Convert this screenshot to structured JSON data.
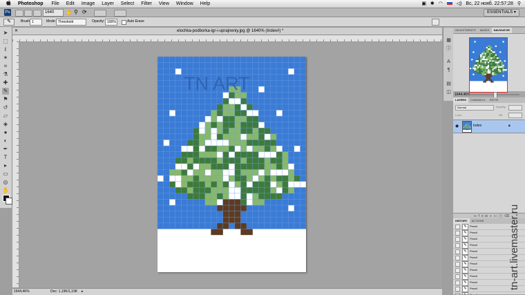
{
  "menubar": {
    "app_name": "Photoshop",
    "menus": [
      "File",
      "Edit",
      "Image",
      "Layer",
      "Select",
      "Filter",
      "View",
      "Window",
      "Help"
    ],
    "clock": "Вс, 22 нояб.  22:57:28"
  },
  "appbar": {
    "logo": "Ps",
    "zoom": "1640",
    "workspace": "ESSENTIALS ▾"
  },
  "options": {
    "brush_label": "Brush:",
    "brush_size": "1",
    "mode_label": "Mode:",
    "mode_value": "Threshold",
    "opacity_label": "Opacity:",
    "opacity_value": "100%",
    "auto_erase_label": "Auto Erase"
  },
  "document": {
    "title": "elochka-podborka-igr-i-uprajneniy.jpg @ 1640% (Index#) *",
    "logo_text": "TN   ART",
    "status_zoom": "1644,46%",
    "status_doc": "Doc: 1,19K/1,19K"
  },
  "panels": {
    "navigator_tabs": [
      "ADJUSTMENTS",
      "MASKS",
      "NAVIGATOR"
    ],
    "nav_zoom": "1644,46%",
    "layers_tabs": [
      "LAYERS",
      "CHANNELS",
      "PATHS"
    ],
    "blend_mode": "Normal",
    "opacity_label": "Opacity:",
    "lock_label": "Lock:",
    "fill_label": "Fill:",
    "layer_name": "Index",
    "history_tabs": [
      "HISTORY",
      "ACTIONS"
    ],
    "history_items": [
      "Pencil",
      "Pencil",
      "Pencil",
      "Pencil",
      "Pencil",
      "Pencil",
      "Pencil",
      "Pencil",
      "Pencil",
      "Pencil",
      "Pencil",
      "Pencil",
      "Pencil"
    ]
  },
  "watermark": "tn-art.livemaster.ru",
  "colors": {
    "sky": "#3a7bd5",
    "grid": "#6fa0e6",
    "tree_light": "#87b86c",
    "tree_dark": "#3e7a3c",
    "trunk": "#5c3b22",
    "snow": "#ffffff"
  }
}
